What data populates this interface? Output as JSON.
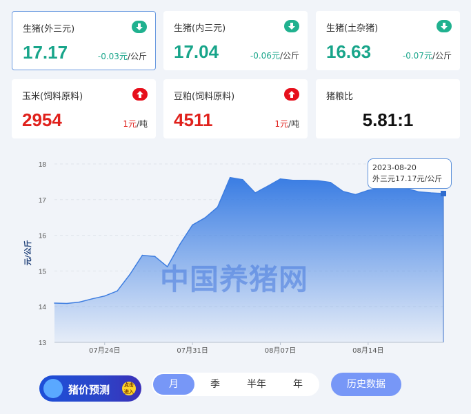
{
  "cards": [
    {
      "title": "生猪(外三元)",
      "value": "17.17",
      "change": "-0.03元",
      "unit": "/公斤",
      "trend": "down"
    },
    {
      "title": "生猪(内三元)",
      "value": "17.04",
      "change": "-0.06元",
      "unit": "/公斤",
      "trend": "down"
    },
    {
      "title": "生猪(土杂猪)",
      "value": "16.63",
      "change": "-0.07元",
      "unit": "/公斤",
      "trend": "down"
    },
    {
      "title": "玉米(饲料原料)",
      "value": "2954",
      "change": "1元",
      "unit": "/吨",
      "trend": "up"
    },
    {
      "title": "豆粕(饲料原料)",
      "value": "4511",
      "change": "1元",
      "unit": "/吨",
      "trend": "up"
    },
    {
      "title": "猪粮比",
      "value": "5.81:1"
    }
  ],
  "colors": {
    "down": "#18a58a",
    "up": "#e0211c",
    "accent": "#7797f7",
    "chart_line": "#3d7de0"
  },
  "watermark": "中国养猪网",
  "tooltip": {
    "date": "2023-08-20",
    "text": "外三元17.17元/公斤"
  },
  "chart_data": {
    "type": "area",
    "ylabel": "元/公斤",
    "ylim": [
      13,
      18
    ],
    "y_ticks": [
      "18",
      "17",
      "16",
      "15",
      "14",
      "13"
    ],
    "x_ticks": [
      "07月24日",
      "07月31日",
      "08月07日",
      "08月14日"
    ],
    "x": [
      "07-20",
      "07-21",
      "07-22",
      "07-23",
      "07-24",
      "07-25",
      "07-26",
      "07-27",
      "07-28",
      "07-29",
      "07-30",
      "07-31",
      "08-01",
      "08-02",
      "08-03",
      "08-04",
      "08-05",
      "08-06",
      "08-07",
      "08-08",
      "08-09",
      "08-10",
      "08-11",
      "08-12",
      "08-13",
      "08-14",
      "08-15",
      "08-16",
      "08-17",
      "08-18",
      "08-19",
      "08-20"
    ],
    "series": [
      {
        "name": "外三元",
        "values": [
          14.1,
          14.09,
          14.13,
          14.22,
          14.3,
          14.44,
          14.9,
          15.44,
          15.41,
          15.12,
          15.75,
          16.29,
          16.49,
          16.79,
          17.62,
          17.56,
          17.19,
          17.38,
          17.58,
          17.54,
          17.54,
          17.53,
          17.48,
          17.23,
          17.14,
          17.26,
          17.33,
          17.45,
          17.32,
          17.22,
          17.19,
          17.17
        ]
      }
    ],
    "grid": true
  },
  "controls": {
    "forecast_label": "猪价预测",
    "forecast_badge": "点击进入",
    "tabs": [
      "月",
      "季",
      "半年",
      "年"
    ],
    "history": "历史数据"
  }
}
